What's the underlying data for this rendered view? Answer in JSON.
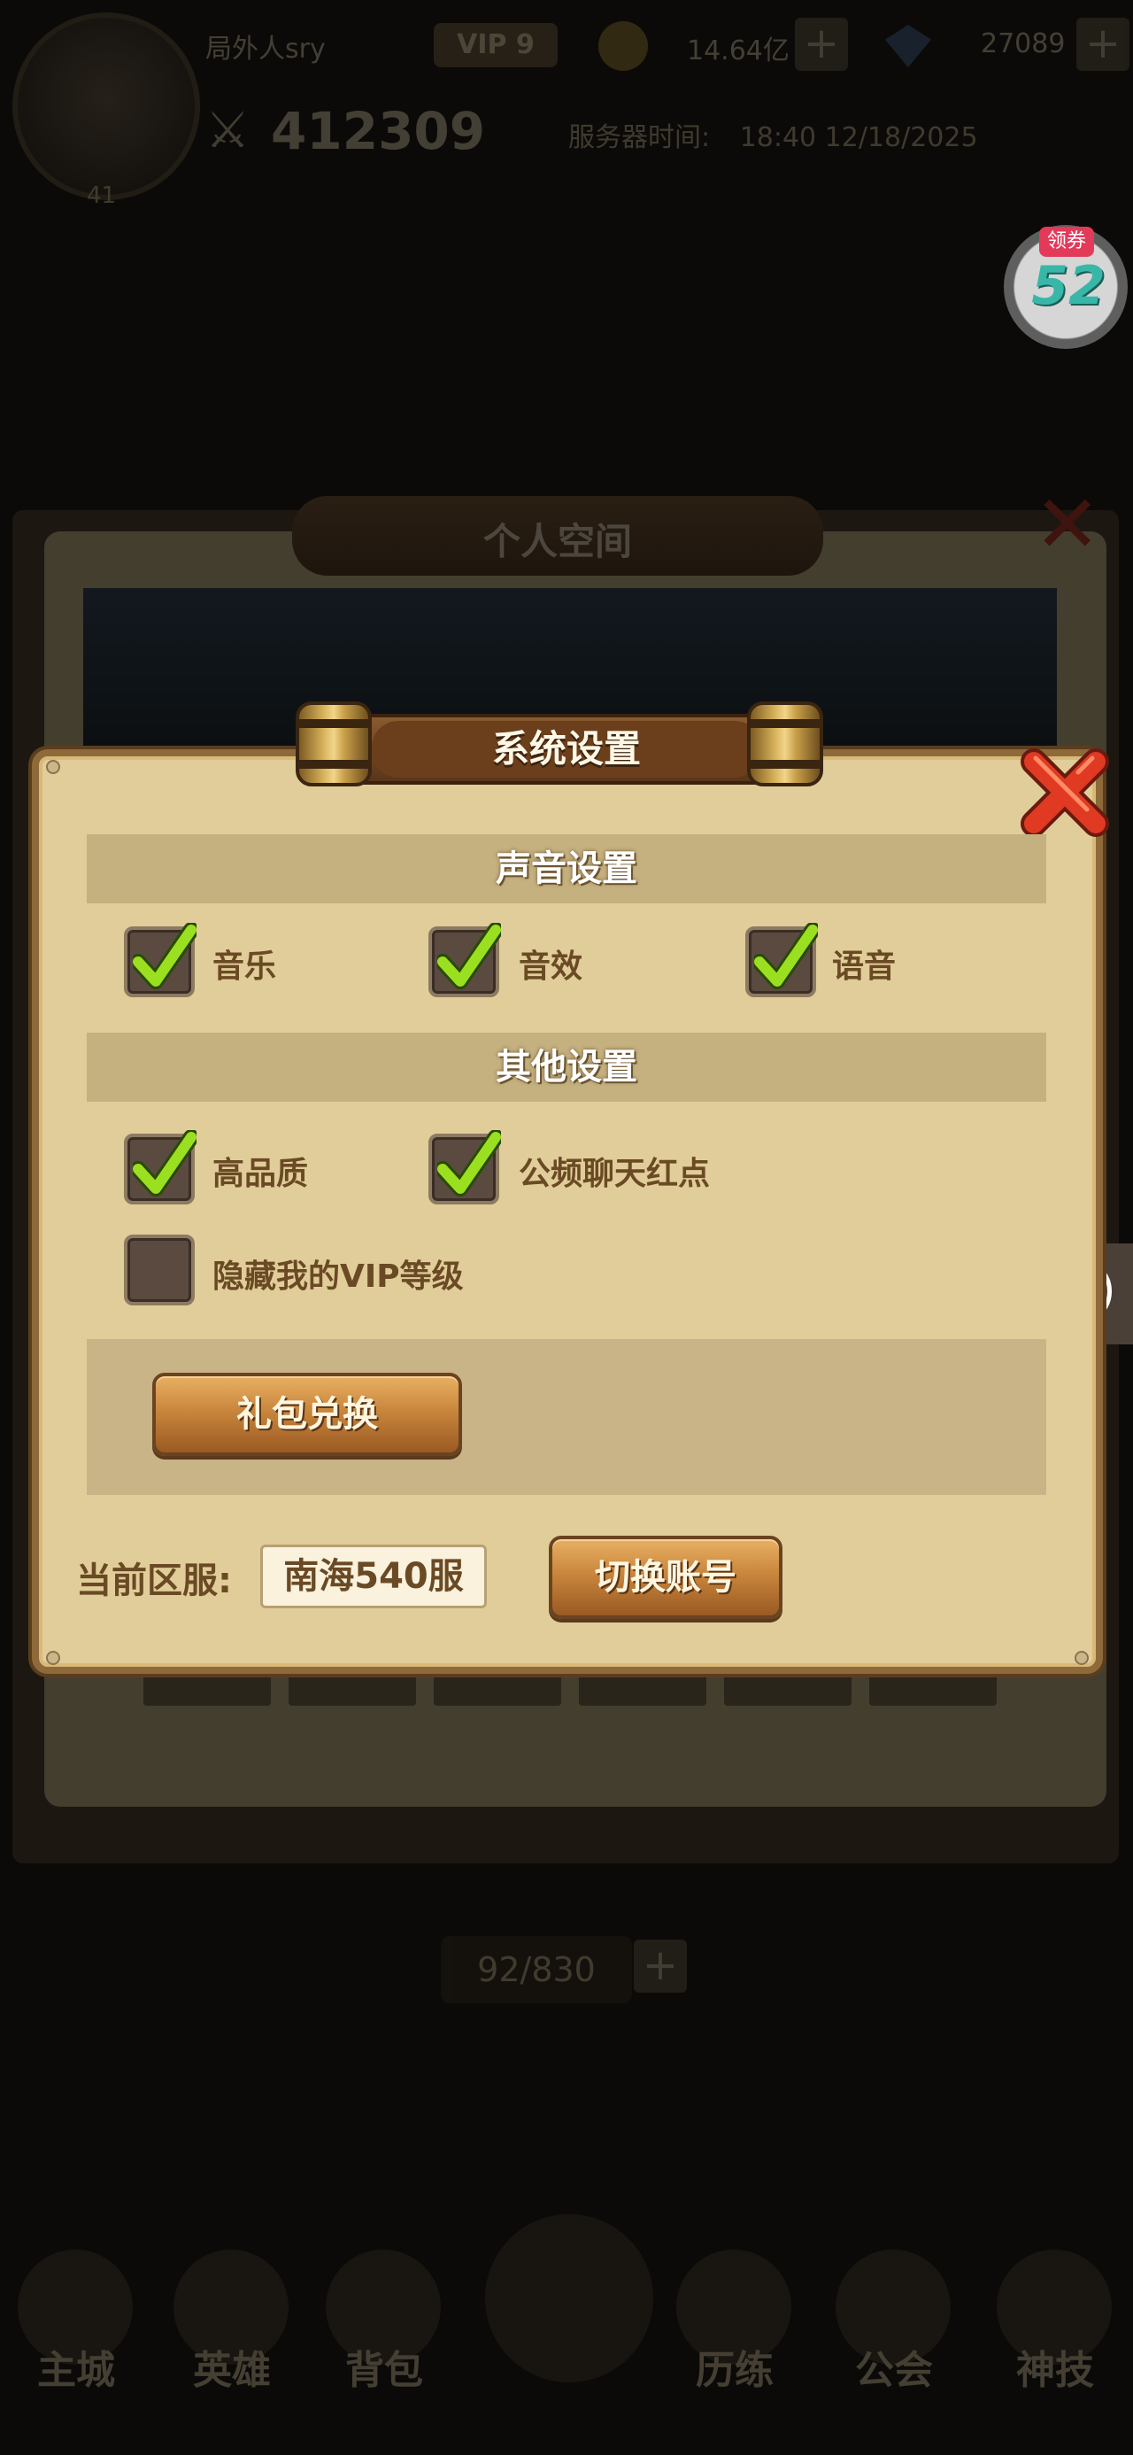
{
  "hud": {
    "player_name": "局外人sry",
    "level": "41",
    "vip": "VIP 9",
    "gold": "14.64亿",
    "gems": "27089",
    "combat_power": "412309",
    "server_time_label": "服务器时间:",
    "server_time_value": "18:40 12/18/2025"
  },
  "coupon": {
    "tag": "领券",
    "number": "52"
  },
  "background_panel": {
    "title": "个人空间",
    "count": "92/830"
  },
  "bottom_nav": {
    "items": [
      "主城",
      "英雄",
      "背包",
      "",
      "历练",
      "公会",
      "神技"
    ]
  },
  "dialog": {
    "title": "系统设置",
    "sound_section_title": "声音设置",
    "sound_options": [
      {
        "label": "音乐",
        "checked": true
      },
      {
        "label": "音效",
        "checked": true
      },
      {
        "label": "语音",
        "checked": true
      }
    ],
    "other_section_title": "其他设置",
    "other_options": [
      {
        "label": "高品质",
        "checked": true
      },
      {
        "label": "公频聊天红点",
        "checked": true
      },
      {
        "label": "隐藏我的VIP等级",
        "checked": false
      }
    ],
    "gift_button": "礼包兑换",
    "current_server_label": "当前区服:",
    "current_server_value": "南海540服",
    "switch_account_button": "切换账号"
  },
  "colors": {
    "dialog_bg": "#e1cd99",
    "section_bar": "#c5b07f",
    "check_green": "#9be020",
    "close_red": "#d9301f",
    "button_orange": "#c9863d"
  }
}
